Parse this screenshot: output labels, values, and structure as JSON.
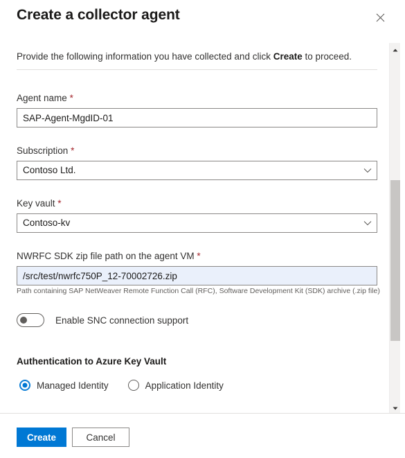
{
  "dialog": {
    "title": "Create a collector agent",
    "close_icon": "close-icon",
    "intro_prefix": "Provide the following information you have collected and click ",
    "intro_emphasis": "Create",
    "intro_suffix": " to proceed."
  },
  "form": {
    "agent_name": {
      "label": "Agent name",
      "required_marker": "*",
      "value": "SAP-Agent-MgdID-01",
      "placeholder": ""
    },
    "subscription": {
      "label": "Subscription",
      "required_marker": "*",
      "value": "Contoso Ltd.",
      "chevron_icon": "chevron-down-icon"
    },
    "key_vault": {
      "label": "Key vault",
      "required_marker": "*",
      "value": "Contoso-kv",
      "chevron_icon": "chevron-down-icon"
    },
    "nwrfc_sdk_path": {
      "label": "NWRFC SDK zip file path on the agent VM",
      "required_marker": "*",
      "value": "/src/test/nwrfc750P_12-70002726.zip",
      "placeholder": "",
      "help_text": "Path containing SAP NetWeaver Remote Function Call (RFC), Software Development Kit (SDK) archive (.zip file)"
    },
    "snc_toggle": {
      "label": "Enable SNC connection support",
      "state": "off"
    },
    "authentication": {
      "heading": "Authentication to Azure Key Vault",
      "options": [
        {
          "label": "Managed Identity",
          "selected": true
        },
        {
          "label": "Application Identity",
          "selected": false
        }
      ]
    }
  },
  "scrollbar": {
    "up_icon": "triangle-up-icon",
    "down_icon": "triangle-down-icon"
  },
  "footer": {
    "create_label": "Create",
    "cancel_label": "Cancel"
  },
  "colors": {
    "accent": "#0078d4",
    "required": "#a4262c",
    "text": "#323130",
    "border": "#8a8886",
    "focus_fill": "#eaf0fb"
  }
}
